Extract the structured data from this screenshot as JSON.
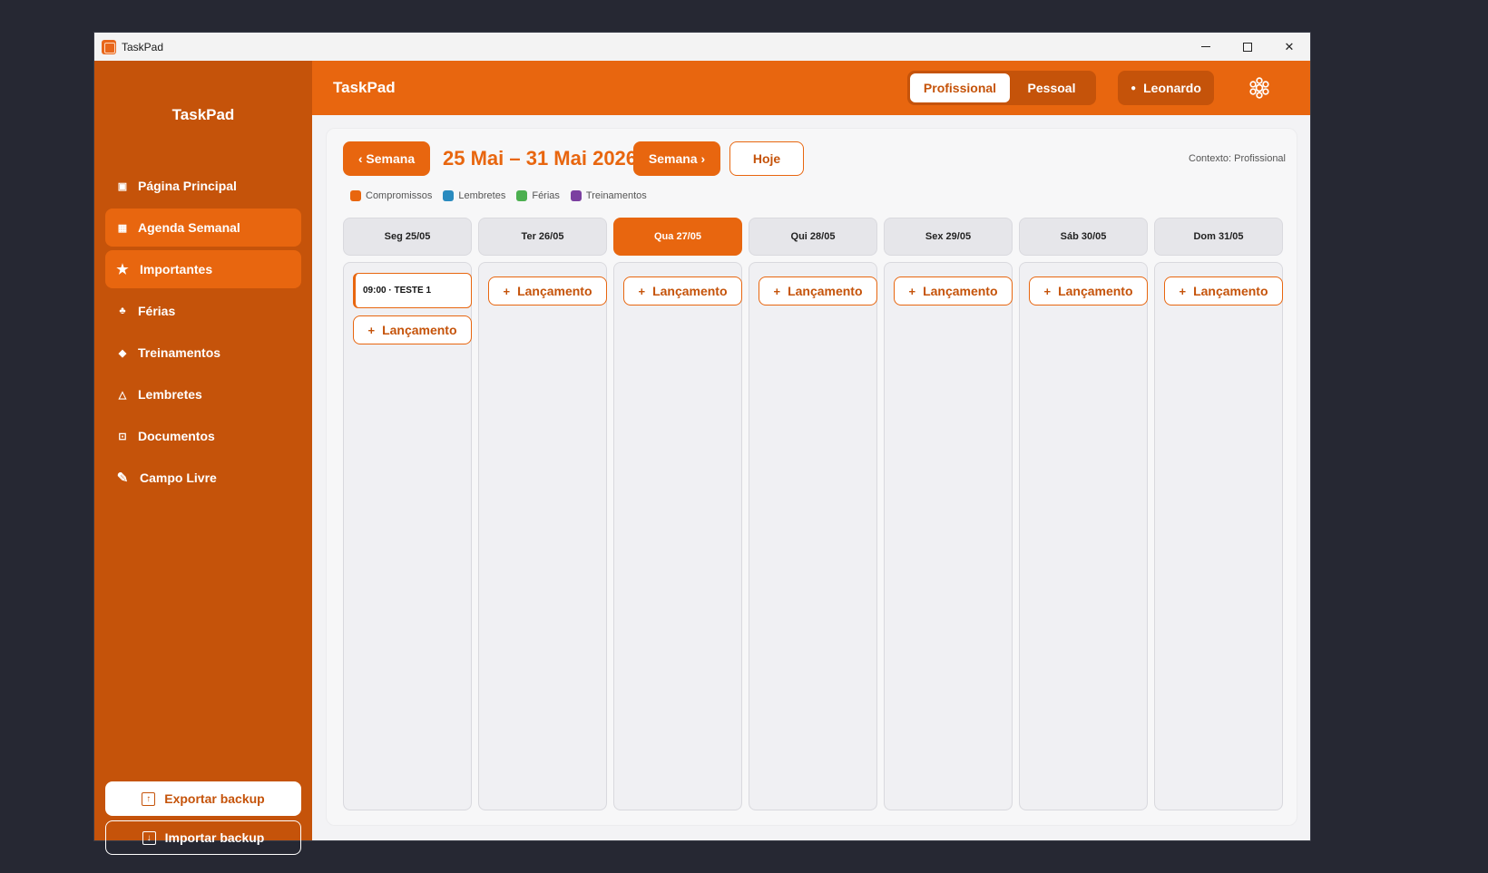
{
  "window": {
    "title": "TaskPad"
  },
  "sidebar": {
    "brand": "TaskPad",
    "items": [
      {
        "label": "Página Principal",
        "icon": "home-icon",
        "active": false
      },
      {
        "label": "Agenda Semanal",
        "icon": "calendar-icon",
        "active": true
      },
      {
        "label": "Importantes",
        "icon": "star-icon",
        "active": true
      },
      {
        "label": "Férias",
        "icon": "palm-tree-icon",
        "active": false
      },
      {
        "label": "Treinamentos",
        "icon": "training-icon",
        "active": false
      },
      {
        "label": "Lembretes",
        "icon": "bell-icon",
        "active": false
      },
      {
        "label": "Documentos",
        "icon": "lock-icon",
        "active": false
      },
      {
        "label": "Campo Livre",
        "icon": "pencil-icon",
        "active": false
      }
    ],
    "export_label": "Exportar backup",
    "import_label": "Importar backup"
  },
  "header": {
    "title": "TaskPad",
    "context_options": [
      "Profissional",
      "Pessoal"
    ],
    "context_selected": "Profissional",
    "user_name": "Leonardo"
  },
  "toolbar": {
    "prev_label": "‹ Semana",
    "range_title": "25 Mai – 31 Mai 2026",
    "next_label": "Semana ›",
    "today_label": "Hoje",
    "context_label": "Contexto: Profissional"
  },
  "legend": [
    {
      "label": "Compromissos",
      "color": "#e8660f"
    },
    {
      "label": "Lembretes",
      "color": "#2a8bbf"
    },
    {
      "label": "Férias",
      "color": "#4caf50"
    },
    {
      "label": "Treinamentos",
      "color": "#7b3fa0"
    }
  ],
  "days": [
    {
      "label": "Seg  25/05",
      "today": false,
      "events": [
        "09:00 · TESTE 1"
      ]
    },
    {
      "label": "Ter  26/05",
      "today": false,
      "events": []
    },
    {
      "label": "Qua  27/05",
      "today": true,
      "events": []
    },
    {
      "label": "Qui  28/05",
      "today": false,
      "events": []
    },
    {
      "label": "Sex  29/05",
      "today": false,
      "events": []
    },
    {
      "label": "Sáb  30/05",
      "today": false,
      "events": []
    },
    {
      "label": "Dom  31/05",
      "today": false,
      "events": []
    }
  ],
  "add_label": "Lançamento",
  "colors": {
    "accent": "#e8660f",
    "sidebar": "#c5530a"
  }
}
